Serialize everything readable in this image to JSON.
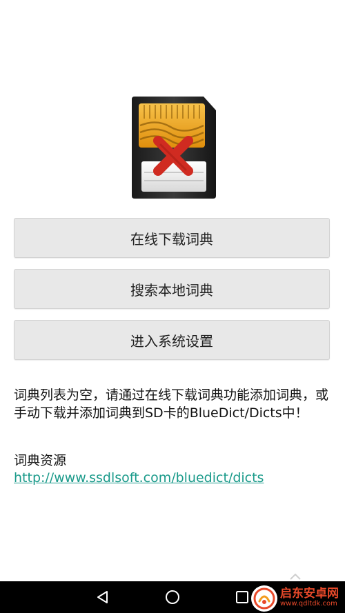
{
  "main": {
    "buttons": {
      "download_online": "在线下载词典",
      "search_local": "搜索本地词典",
      "system_settings": "进入系统设置"
    },
    "empty_message": "词典列表为空，请通过在线下载词典功能添加词典，或手动下载并添加词典到SD卡的BlueDict/Dicts中！",
    "resources_title": "词典资源",
    "resources_link": "http://www.ssdlsoft.com/bluedict/dicts"
  },
  "watermark": {
    "name": "启东安卓网",
    "url": "www.qdltdk.com"
  },
  "icons": {
    "sd_card": "sd-card-error-icon",
    "back": "back-icon",
    "home": "home-icon",
    "recent": "recent-apps-icon",
    "chevron": "chevron-up-icon"
  },
  "colors": {
    "link": "#1a9a8a",
    "button_bg": "#e8e8e8",
    "nav_bg": "#000000",
    "error_x": "#d02b21",
    "card_gold": "#f0a71a"
  }
}
